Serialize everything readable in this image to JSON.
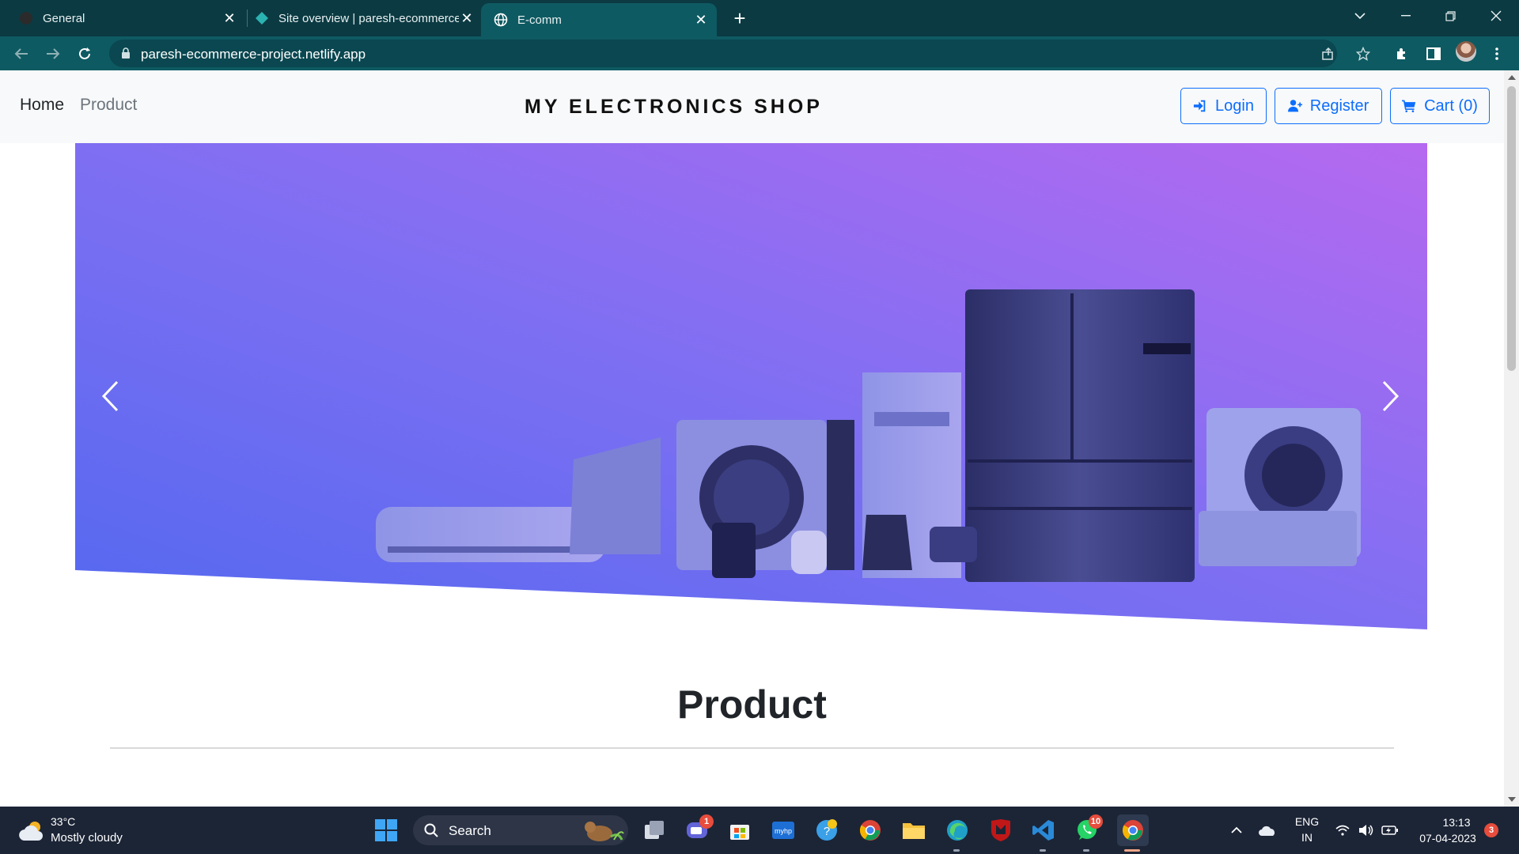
{
  "browser": {
    "tabs": [
      {
        "label": "General"
      },
      {
        "label": "Site overview | paresh-ecommerce"
      },
      {
        "label": "E-comm"
      }
    ],
    "url": "paresh-ecommerce-project.netlify.app"
  },
  "site": {
    "nav_links": [
      "Home",
      "Product"
    ],
    "brand": "MY ELECTRONICS SHOP",
    "buttons": {
      "login": "Login",
      "register": "Register",
      "cart": "Cart (0)"
    },
    "section_title": "Product"
  },
  "taskbar": {
    "weather_temp": "33°C",
    "weather_desc": "Mostly cloudy",
    "search_label": "Search",
    "language": "ENG",
    "region": "IN",
    "time": "13:13",
    "date": "07-04-2023",
    "badges": {
      "teams": "1",
      "whatsapp": "10",
      "notifications": "3"
    }
  },
  "colors": {
    "tab_strip": "#0b3a42",
    "toolbar": "#0e5a62",
    "primary": "#0d6efd",
    "hero_gradient_start": "#5b6cf0",
    "hero_gradient_end": "#b26af0"
  }
}
